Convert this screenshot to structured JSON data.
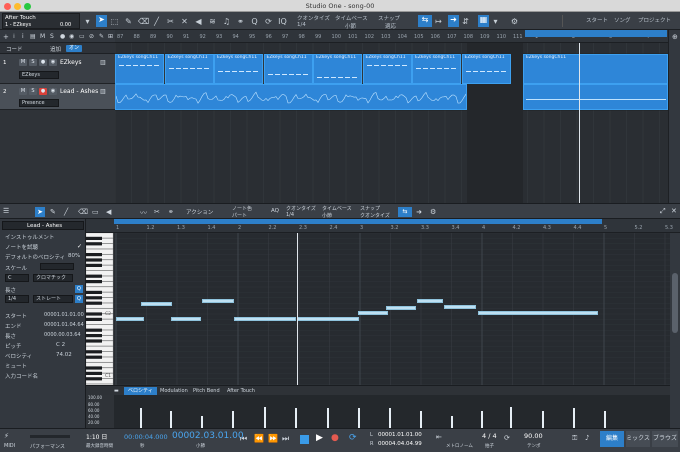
{
  "window": {
    "title": "Studio One - song-00"
  },
  "toolbar": {
    "channel_title": "After Touch",
    "channel_sub": "1 - EZkeys",
    "channel_value": "0.00",
    "quantize_label": "クオンタイズ",
    "quantize_value": "1/4",
    "timebase_label": "タイムベース",
    "timebase_value": "小節",
    "snap_label": "スナップ",
    "snap_value": "適応",
    "nav_start": "スタート",
    "nav_song": "ソング",
    "nav_project": "プロジェクト"
  },
  "tracks_header": {
    "code_label": "コード",
    "add_label": "追加",
    "on_label": "オン"
  },
  "tracks": [
    {
      "number": "1",
      "name": "EZkeys",
      "instrument": "EZkeys"
    },
    {
      "number": "2",
      "name": "Lead - Ashes",
      "instrument": "Presence"
    }
  ],
  "arrange_ruler": [
    "87",
    "88",
    "89",
    "90",
    "91",
    "92",
    "93",
    "94",
    "95",
    "96",
    "97",
    "98",
    "99",
    "100",
    "101",
    "102",
    "103",
    "104",
    "105",
    "106",
    "107",
    "108",
    "109",
    "110",
    "111",
    "1",
    "2",
    "3",
    "4"
  ],
  "clips": {
    "ezkeys_label": "EZkeys songCh11",
    "ezkeys_headers": [
      "EZkeys songCh11",
      "EZkeys songCh11",
      "EZkeys songCh11",
      "EZkeys songCh11",
      "EZkeys songCh11",
      "EZkeys songCh11",
      "EZkeys songCh11",
      "EZkeys songCh11"
    ]
  },
  "editor_toolbar": {
    "action_label": "アクション",
    "note_color_label": "ノート色",
    "note_color_value": "パート",
    "aq_label": "AQ",
    "quantize_label": "クオンタイズ",
    "quantize_value": "1/4",
    "timebase_label": "タイムベース",
    "timebase_value": "小節",
    "snap_label": "スナップ",
    "snap_value": "クオンタイズ"
  },
  "inspector": {
    "track_name": "Lead - Ashes",
    "instrument_label": "インストゥルメント",
    "audition_label": "ノートを試聴",
    "default_velocity_label": "デフォルトのベロシティ",
    "default_velocity_value": "80%",
    "scale_label": "スケール",
    "scale_root": "C",
    "scale_type": "クロマチック",
    "length_label": "長さ",
    "length_value": "1/4",
    "length_type": "ストレート",
    "start_label": "スタート",
    "start_value": "00001.01.01.00",
    "end_label": "エンド",
    "end_value": "00001.01.04.64",
    "len_label": "長さ",
    "len_value": "0000.00.03.64",
    "pitch_label": "ピッチ",
    "pitch_value": "C 2",
    "velocity_label": "ベロシティ",
    "velocity_value": "74.02",
    "mute_label": "ミュート",
    "input_code_label": "入力コード名"
  },
  "editor_ruler": [
    "1",
    "1.2",
    "1.3",
    "1.4",
    "2",
    "2.2",
    "2.3",
    "2.4",
    "3",
    "3.2",
    "3.3",
    "3.4",
    "4",
    "4.2",
    "4.3",
    "4.4",
    "5",
    "5.2",
    "5.3"
  ],
  "piano": {
    "c2_label": "C2",
    "c1_label": "C1"
  },
  "velocity_lane": {
    "tabs": [
      "ベロシティ",
      "Modulation",
      "Pitch Bend",
      "After Touch"
    ],
    "scale": [
      "100.00",
      "80.00",
      "60.00",
      "40.00",
      "20.00"
    ],
    "values": [
      74,
      62,
      45,
      62,
      78,
      74,
      74,
      74,
      74,
      62,
      45,
      62,
      78,
      62,
      74,
      62
    ]
  },
  "transport": {
    "midi_label": "MIDI",
    "performance_label": "パフォーマンス",
    "time_elapsed": "1:10 日",
    "time_elapsed_sub": "最大録音時間",
    "position_seconds": "00:00:04.000",
    "position_seconds_sub": "秒",
    "position_bars": "00002.03.01.00",
    "position_bars_sub": "小節",
    "loop_start": "00001.01.01.00",
    "loop_end": "00004.04.04.99",
    "loop_l_label": "L",
    "loop_r_label": "R",
    "metronome_label": "メトロノーム",
    "signature": "4 / 4",
    "signature_sub": "拍子",
    "tempo": "90.00",
    "tempo_sub": "テンポ",
    "tab_edit": "編集",
    "tab_mix": "ミックス",
    "tab_browse": "ブラウズ"
  }
}
